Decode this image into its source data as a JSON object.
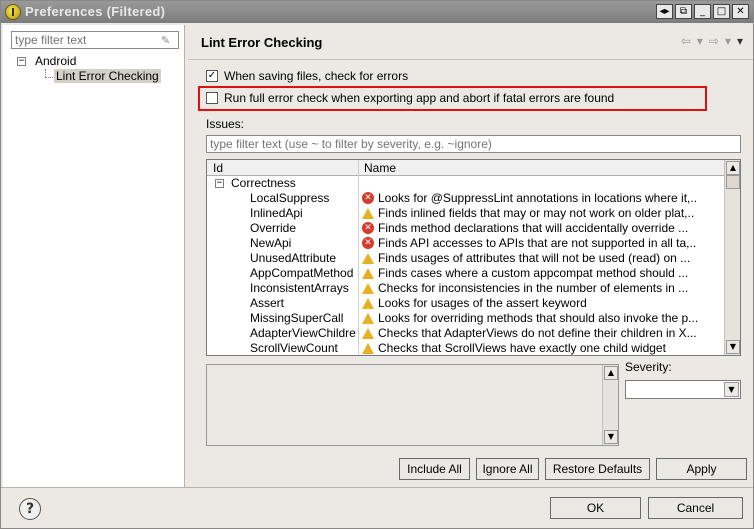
{
  "window": {
    "title": "Preferences (Filtered)",
    "controls": [
      "◂▸",
      "⧉",
      "_",
      "□",
      "✕"
    ]
  },
  "left": {
    "filter_placeholder": "type filter text",
    "tree": {
      "root": "Android",
      "child": "Lint Error Checking"
    }
  },
  "main": {
    "title": "Lint Error Checking",
    "checks": {
      "on_save_label": "When saving files, check for errors",
      "on_save_checked": true,
      "export_label": "Run full error check when exporting app and abort if fatal errors are found",
      "export_checked": false
    },
    "issues_label": "Issues:",
    "issues_filter_placeholder": "type filter text (use ~ to filter by severity, e.g. ~ignore)",
    "table": {
      "columns": [
        "Id",
        "Name"
      ],
      "category": "Correctness",
      "rows": [
        {
          "id": "LocalSuppress",
          "severity": "error",
          "name": "Looks for @SuppressLint annotations in locations where it,.."
        },
        {
          "id": "InlinedApi",
          "severity": "warning",
          "name": "Finds inlined fields that may or may not work on older plat,.."
        },
        {
          "id": "Override",
          "severity": "error",
          "name": "Finds method declarations that will accidentally override ..."
        },
        {
          "id": "NewApi",
          "severity": "error",
          "name": "Finds API accesses to APIs that are not supported in all ta,.."
        },
        {
          "id": "UnusedAttribute",
          "severity": "warning",
          "name": "Finds usages of attributes that will not be used (read) on ..."
        },
        {
          "id": "AppCompatMethod",
          "severity": "warning",
          "name": "Finds cases where a custom appcompat method should ..."
        },
        {
          "id": "InconsistentArrays",
          "severity": "warning",
          "name": "Checks for inconsistencies in the number of elements in ..."
        },
        {
          "id": "Assert",
          "severity": "warning",
          "name": "Looks for usages of the assert keyword"
        },
        {
          "id": "MissingSuperCall",
          "severity": "warning",
          "name": "Looks for overriding methods that should also invoke the p..."
        },
        {
          "id": "AdapterViewChildren",
          "severity": "warning",
          "name": "Checks that AdapterViews do not define their children in X..."
        },
        {
          "id": "ScrollViewCount",
          "severity": "warning",
          "name": "Checks that ScrollViews have exactly one child widget"
        }
      ]
    },
    "severity_label": "Severity:",
    "severity_value": "",
    "buttons": {
      "include_all": "Include All",
      "ignore_all": "Ignore All",
      "restore_defaults": "Restore Defaults",
      "apply": "Apply"
    }
  },
  "footer": {
    "help": "?",
    "ok": "OK",
    "cancel": "Cancel"
  },
  "colors": {
    "title_bar": "#8a8a8a",
    "highlight_box": "#e01010",
    "error": "#d63a2a",
    "warning": "#e8b020"
  }
}
